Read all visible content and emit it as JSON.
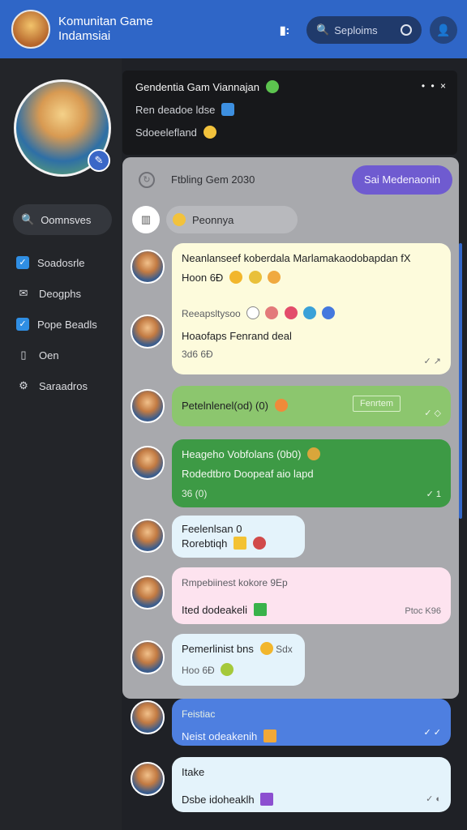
{
  "header": {
    "title_line1": "Komunitan Game",
    "title_line2": "Indamsiai",
    "menu_glyph": "▮:",
    "search_placeholder": "Seploims",
    "icons": [
      "search-icon",
      "loading-ring-icon",
      "user-icon"
    ]
  },
  "sidebar": {
    "search_label": "Oomnsves",
    "items": [
      {
        "label": "Soadosrle",
        "icon": "checkbox-checked-icon",
        "checked": true
      },
      {
        "label": "Deogphs",
        "icon": "envelope-icon",
        "checked": false
      },
      {
        "label": "Pope Beadls",
        "icon": "checkbox-checked-icon",
        "checked": true
      },
      {
        "label": "Oen",
        "icon": "document-icon",
        "checked": false
      },
      {
        "label": "Saraadros",
        "icon": "settings-icon",
        "checked": false
      }
    ]
  },
  "top_card": {
    "line1": "Gendentia Gam Viannajan",
    "line2": "Ren deadoe ldse",
    "line3": "Sdoeelefland",
    "menu": "• • ×"
  },
  "panel": {
    "title": "Ftbling Gem 2030",
    "action_button": "Sai Medenaonin",
    "filter_label": "Peonnya"
  },
  "messages": [
    {
      "line1": "Neanlanseef koberdala Marlamakaodobapdan fX",
      "line2": "Hoon 6Ð",
      "line3": "Reeapsltysoo",
      "line4": "Hoaofaps  Fenrand deal",
      "meta": "3d6 6Ð"
    },
    {
      "line1": "Petelnlenel(od) (0)",
      "chip": "Fenrtem"
    },
    {
      "line1": "Heageho Vobfolans (0b0)",
      "line2": "Rodedtbro Doopeaf aio lapd",
      "line3": "36 (0)",
      "meta": "1"
    },
    {
      "line1": "Feelenlsan 0",
      "line2": "Rorebtiqh"
    },
    {
      "line1": "Rmpebiinest kokore 9Ep",
      "line2": "Ited dodeakeli",
      "meta": "Ptoc K96"
    },
    {
      "line1": "Pemerlinist bns",
      "line1b": "Sdx",
      "line2": "Hoo 6Ð"
    },
    {
      "line1": "Feistiac",
      "line2": "Neist odeakenih"
    },
    {
      "line1": "Itake",
      "line2": "Dsbe idoheaklh"
    }
  ],
  "colors": {
    "header": "#2f66c7",
    "accent_button": "#6f5bd0",
    "dark_bg": "#1f2126"
  }
}
